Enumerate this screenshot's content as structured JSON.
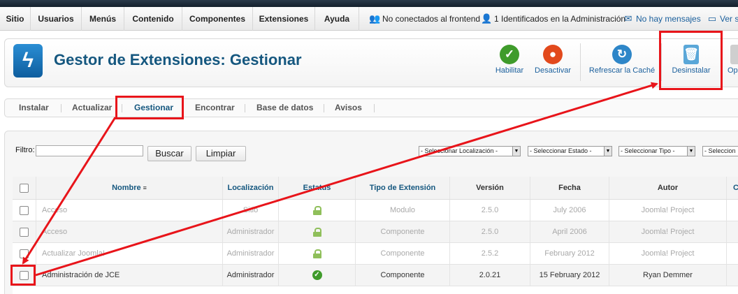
{
  "menu": {
    "items": [
      "Sitio",
      "Usuarios",
      "Menús",
      "Contenido",
      "Componentes",
      "Extensiones",
      "Ayuda"
    ],
    "status": {
      "frontend": "No conectados al frontend",
      "admin": "1 Identificados en la Administración",
      "messages": "No hay mensajes",
      "site": "Ver sit"
    }
  },
  "toolbar": {
    "title": "Gestor de Extensiones: Gestionar",
    "buttons": {
      "enable": "Habilitar",
      "disable": "Desactivar",
      "refresh": "Refrescar la Caché",
      "uninstall": "Desinstalar",
      "options": "Op"
    }
  },
  "subnav": {
    "items": [
      "Instalar",
      "Actualizar",
      "Gestionar",
      "Encontrar",
      "Base de datos",
      "Avisos"
    ],
    "active": "Gestionar"
  },
  "filter": {
    "label": "Filtro:",
    "value": "",
    "search_button": "Buscar",
    "clear_button": "Limpiar",
    "selects": {
      "location": "- Seleccionar Localización -",
      "state": "- Seleccionar Estado -",
      "type": "- Seleccionar Tipo -",
      "folder": "- Seleccion"
    }
  },
  "table": {
    "headers": {
      "name": "Nombre",
      "location": "Localización",
      "status": "Estatus",
      "type": "Tipo de Extensión",
      "version": "Versión",
      "date": "Fecha",
      "author": "Autor",
      "extra": "C"
    },
    "rows": [
      {
        "name": "Acceso",
        "location": "Sitio",
        "status": "protected",
        "type": "Modulo",
        "version": "2.5.0",
        "date": "July 2006",
        "author": "Joomla! Project"
      },
      {
        "name": "Acceso",
        "location": "Administrador",
        "status": "protected",
        "type": "Componente",
        "version": "2.5.0",
        "date": "April 2006",
        "author": "Joomla! Project"
      },
      {
        "name": "Actualizar Joomla!",
        "location": "Administrador",
        "status": "protected",
        "type": "Componente",
        "version": "2.5.2",
        "date": "February 2012",
        "author": "Joomla! Project"
      },
      {
        "name": "Administración de JCE",
        "location": "Administrador",
        "status": "enabled",
        "type": "Componente",
        "version": "2.0.21",
        "date": "15 February 2012",
        "author": "Ryan Demmer"
      }
    ]
  },
  "colors": {
    "title_blue": "#15577f",
    "link_blue": "#1a5f9c",
    "annotation_red": "#e8141a",
    "enabled_green": "#3f9b2b"
  }
}
